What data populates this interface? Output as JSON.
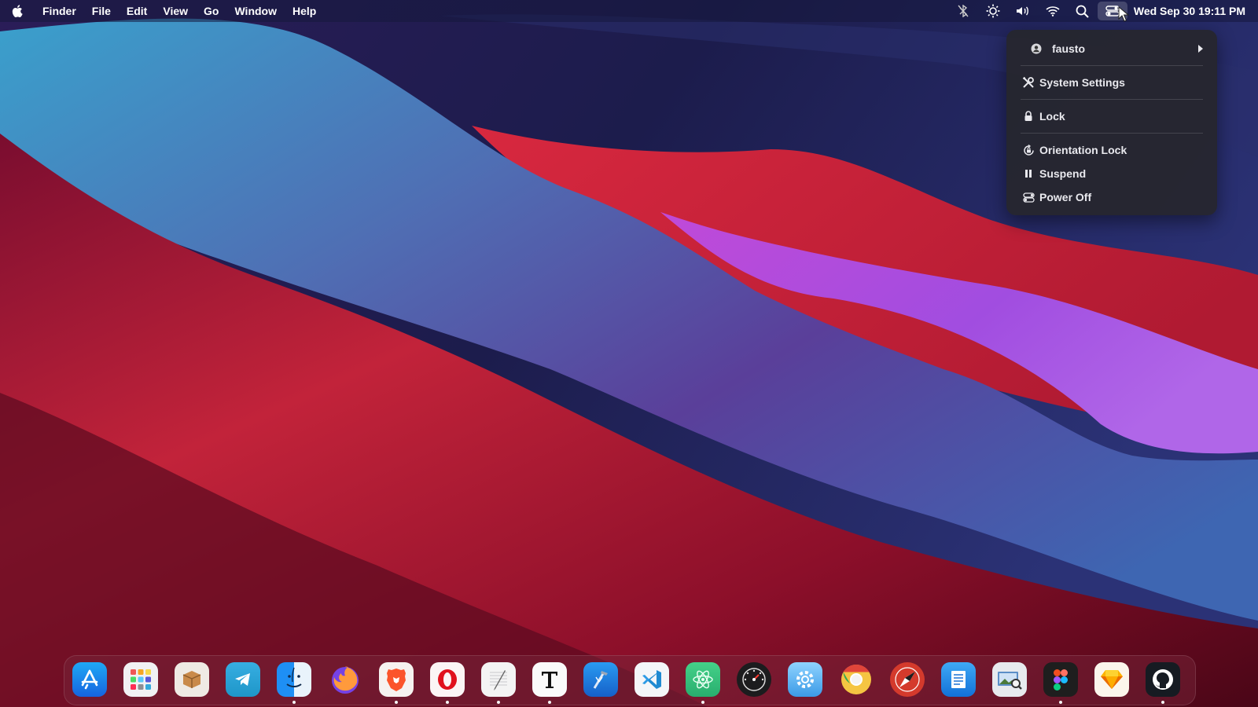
{
  "menubar": {
    "apple_icon": "apple-logo-icon",
    "menus": [
      "Finder",
      "File",
      "Edit",
      "View",
      "Go",
      "Window",
      "Help"
    ],
    "status_icons": [
      "bluetooth-off-icon",
      "brightness-icon",
      "volume-icon",
      "wifi-icon",
      "search-icon",
      "control-center-icon"
    ],
    "clock": "Wed Sep 30  19:11 PM"
  },
  "dropdown": {
    "user": "fausto",
    "system_settings": "System Settings",
    "lock": "Lock",
    "orientation_lock": "Orientation Lock",
    "suspend": "Suspend",
    "power_off": "Power Off"
  },
  "dock": {
    "apps": [
      {
        "icon": "app-store-icon",
        "running": false
      },
      {
        "icon": "launchpad-icon",
        "running": false
      },
      {
        "icon": "package-icon",
        "running": false
      },
      {
        "icon": "telegram-icon",
        "running": false
      },
      {
        "icon": "finder-icon",
        "running": true
      },
      {
        "icon": "firefox-icon",
        "running": false
      },
      {
        "icon": "brave-icon",
        "running": true
      },
      {
        "icon": "opera-icon",
        "running": true
      },
      {
        "icon": "text-editor-icon",
        "running": true
      },
      {
        "icon": "typora-icon",
        "running": true
      },
      {
        "icon": "xcode-icon",
        "running": false
      },
      {
        "icon": "vscode-icon",
        "running": false
      },
      {
        "icon": "atom-icon",
        "running": true
      },
      {
        "icon": "dashboard-icon",
        "running": false
      },
      {
        "icon": "settings-gear-icon",
        "running": false
      },
      {
        "icon": "chrome-icon",
        "running": false
      },
      {
        "icon": "safari-icon",
        "running": false
      },
      {
        "icon": "pages-icon",
        "running": false
      },
      {
        "icon": "preview-icon",
        "running": false
      },
      {
        "icon": "figma-icon",
        "running": true
      },
      {
        "icon": "sketch-icon",
        "running": false
      },
      {
        "icon": "github-icon",
        "running": true
      }
    ]
  }
}
